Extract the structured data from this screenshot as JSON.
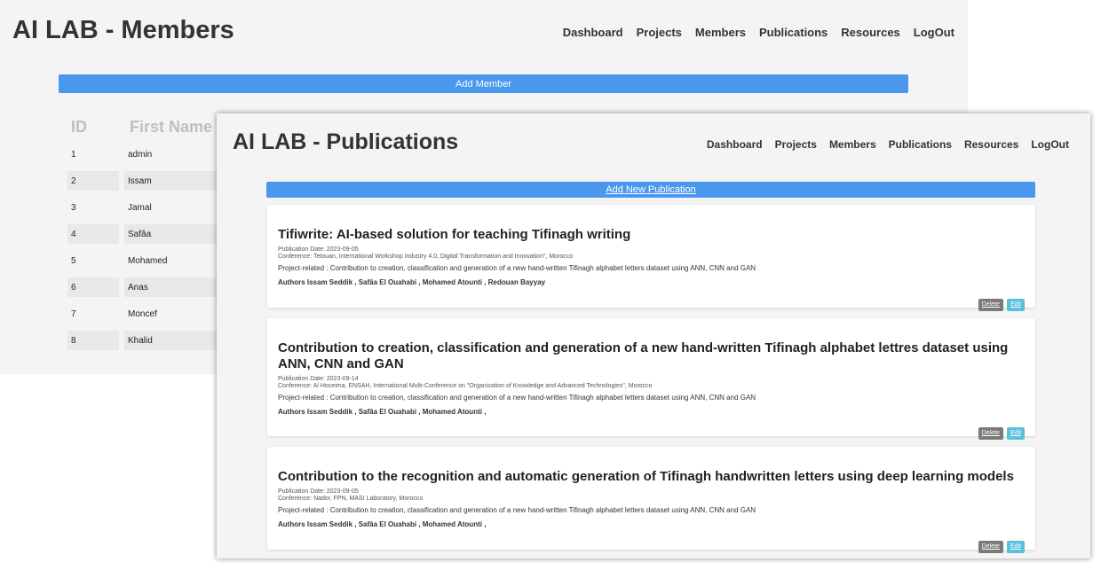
{
  "members_window": {
    "title": "AI LAB - Members",
    "nav": [
      "Dashboard",
      "Projects",
      "Members",
      "Publications",
      "Resources",
      "LogOut"
    ],
    "add_button": "Add Member",
    "table": {
      "headers": [
        "ID",
        "First Name"
      ],
      "rows": [
        {
          "id": "1",
          "first_name": "admin"
        },
        {
          "id": "2",
          "first_name": "Issam"
        },
        {
          "id": "3",
          "first_name": "Jamal"
        },
        {
          "id": "4",
          "first_name": "Safâa"
        },
        {
          "id": "5",
          "first_name": "Mohamed"
        },
        {
          "id": "6",
          "first_name": "Anas"
        },
        {
          "id": "7",
          "first_name": "Moncef"
        },
        {
          "id": "8",
          "first_name": "Khalid"
        }
      ]
    }
  },
  "publications_window": {
    "title": "AI LAB - Publications",
    "nav": [
      "Dashboard",
      "Projects",
      "Members",
      "Publications",
      "Resources",
      "LogOut"
    ],
    "add_button": "Add New Publication",
    "delete_label": "Delete",
    "edit_label": "Edit",
    "publications": [
      {
        "title": "Tifiwrite: AI-based solution for teaching Tifinagh writing",
        "date": "Publication Date: 2023-09-05",
        "conference": "Conference: Tetouan, International Workshop Industry 4.0, Digital Transformation and Innovation\", Morocco",
        "project": "Project-related : Contribution to creation, classification and generation of a new hand-written Tifinagh alphabet letters dataset using ANN, CNN and GAN",
        "authors": "Authors Issam Seddik , Safâa El Ouahabi , Mohamed Atounti , Redouan Bayyay"
      },
      {
        "title": "Contribution to creation, classification and generation of a new hand-written Tifinagh alphabet lettres dataset using ANN, CNN and GAN",
        "date": "Publication Date: 2023-09-14",
        "conference": "Conference: Al Hoceima, ENSAH, International Multi-Conference on \"Organization of Knowledge and Advanced Technologies\", Morocco",
        "project": "Project-related : Contribution to creation, classification and generation of a new hand-written Tifinagh alphabet letters dataset using ANN, CNN and GAN",
        "authors": "Authors Issam Seddik , Safâa El Ouahabi , Mohamed Atounti ,"
      },
      {
        "title": "Contribution to the recognition and automatic generation of Tifinagh handwritten letters using deep learning models",
        "date": "Publication Date: 2023-09-05",
        "conference": "Conference: Nador, FPN, MASI Laboratory, Morocco",
        "project": "Project-related : Contribution to creation, classification and generation of a new hand-written Tifinagh alphabet letters dataset using ANN, CNN and GAN",
        "authors": "Authors Issam Seddik , Safâa El Ouahabi , Mohamed Atounti ,"
      }
    ]
  },
  "colors": {
    "accent": "#4a98ee",
    "edit": "#5bc0de",
    "delete": "#7a7a7a",
    "background": "#f4f4f4"
  }
}
